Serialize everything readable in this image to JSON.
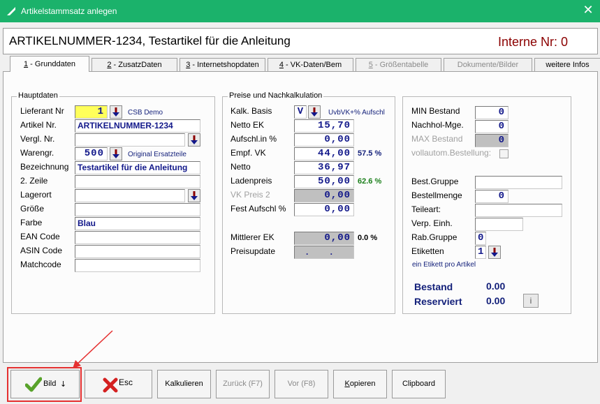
{
  "window": {
    "title": "Artikelstammsatz anlegen",
    "close_glyph": "✕",
    "accent_color": "#1bb26b"
  },
  "header": {
    "title": "ARTIKELNUMMER-1234, Testartikel für die Anleitung",
    "interne_nr": "Interne Nr: 0"
  },
  "tabs": [
    {
      "key": "1",
      "label": " - Grunddaten",
      "active": true
    },
    {
      "key": "2",
      "label": " - ZusatzDaten"
    },
    {
      "key": "3",
      "label": " - Internetshopdaten"
    },
    {
      "key": "4",
      "label": " - VK-Daten/Bem"
    },
    {
      "key": "5",
      "label": " - Größentabelle",
      "disabled": true
    },
    {
      "key": "",
      "label": "Dokumente/Bilder",
      "disabled": true
    },
    {
      "key": "",
      "label": "weitere Infos"
    }
  ],
  "hauptdaten": {
    "title": "Hauptdaten",
    "lieferant_nr": {
      "label": "Lieferant Nr",
      "value": "1",
      "hint": "CSB Demo"
    },
    "artikel_nr": {
      "label": "Artikel Nr.",
      "value": "ARTIKELNUMMER-1234"
    },
    "vergl_nr": {
      "label": "Vergl. Nr.",
      "value": ""
    },
    "warengr": {
      "label": "Warengr.",
      "value": "500",
      "hint": "Original Ersatzteile"
    },
    "bezeichnung": {
      "label": "Bezeichnung",
      "value": "Testartikel für die Anleitung"
    },
    "zeile2": {
      "label": "2. Zeile",
      "value": ""
    },
    "lagerort": {
      "label": "Lagerort",
      "value": ""
    },
    "groesse": {
      "label": "Größe",
      "value": ""
    },
    "farbe": {
      "label": "Farbe",
      "value": "Blau"
    },
    "ean": {
      "label": "EAN Code",
      "value": ""
    },
    "asin": {
      "label": "ASIN Code",
      "value": ""
    },
    "matchcode": {
      "label": "Matchcode",
      "value": ""
    }
  },
  "preise": {
    "title": "Preise und Nachkalkulation",
    "kalk_basis": {
      "label": "Kalk. Basis",
      "value": "V",
      "hint": "UvbVK+% Aufschl"
    },
    "netto_ek": {
      "label": "Netto EK",
      "value": "15,70"
    },
    "aufschl": {
      "label": "Aufschl.in %",
      "value": "0,00"
    },
    "empf_vk": {
      "label": "Empf. VK",
      "value": "44,00",
      "hint": "57.5 %"
    },
    "netto": {
      "label": "Netto",
      "value": "36,97"
    },
    "ladenpreis": {
      "label": "Ladenpreis",
      "value": "50,00",
      "hint": "62.6 %"
    },
    "vk_preis2": {
      "label": "VK Preis 2",
      "value": "0,00"
    },
    "fest_aufschl": {
      "label": "Fest Aufschl %",
      "value": "0,00"
    },
    "mittlerer_ek": {
      "label": "Mittlerer EK",
      "value": "0,00",
      "hint": "0.0 %"
    },
    "preisupdate": {
      "label": "Preisupdate",
      "value": ". ."
    }
  },
  "bestand": {
    "min_bestand": {
      "label": "MIN Bestand",
      "value": "0"
    },
    "nachhol": {
      "label": "Nachhol-Mge.",
      "value": "0"
    },
    "max_bestand": {
      "label": "MAX Bestand",
      "value": "0"
    },
    "vollautom": {
      "label": "vollautom.Bestellung:"
    },
    "best_gruppe": {
      "label": "Best.Gruppe",
      "value": ""
    },
    "bestellmenge": {
      "label": "Bestellmenge",
      "value": "0"
    },
    "teileart": {
      "label": "Teileart:",
      "value": ""
    },
    "verp_einh": {
      "label": "Verp. Einh.",
      "value": ""
    },
    "rab_gruppe": {
      "label": "Rab.Gruppe",
      "value": "0"
    },
    "etiketten": {
      "label": "Etiketten",
      "value": "1",
      "hint": "ein Etikett pro Artikel"
    },
    "bestand": {
      "label": "Bestand",
      "value": "0.00"
    },
    "reserviert": {
      "label": "Reserviert",
      "value": "0.00"
    },
    "info_glyph": "i"
  },
  "buttons": {
    "bild": "Bild",
    "bild_arrow": "↓",
    "esc": "Esc",
    "kalkulieren": "Kalkulieren",
    "zurueck": "Zurück (F7)",
    "vor": "Vor (F8)",
    "kopieren_key": "K",
    "kopieren_rest": "opieren",
    "clipboard": "Clipboard"
  }
}
